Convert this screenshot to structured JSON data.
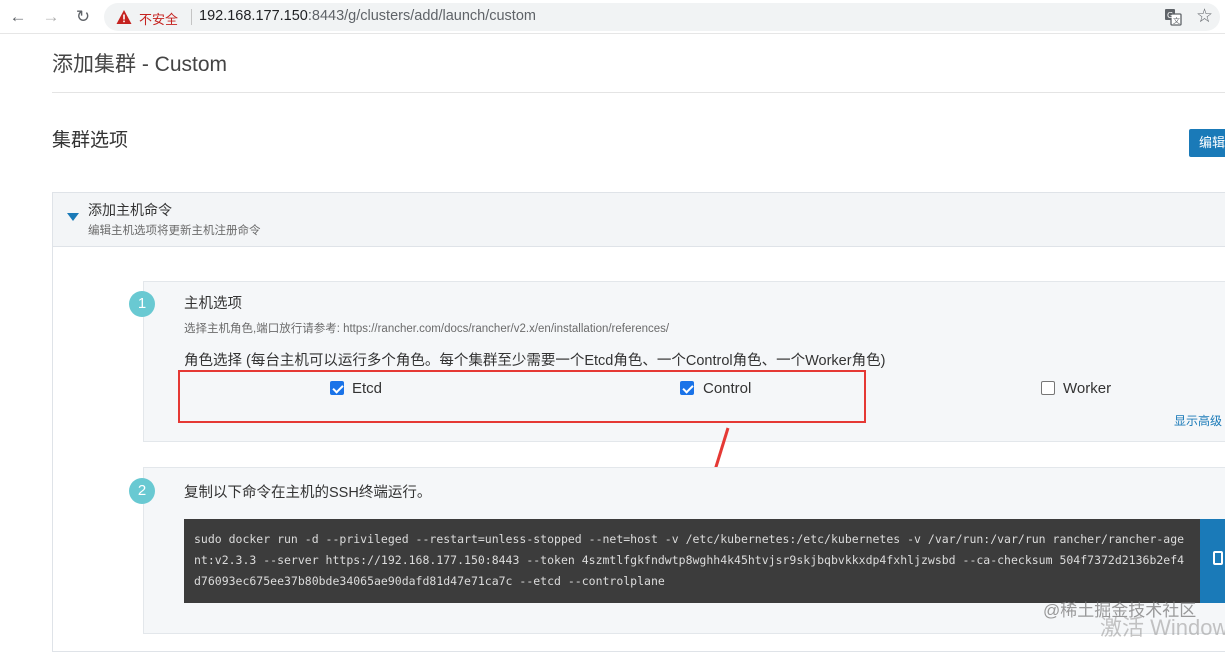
{
  "browser": {
    "security_label": "不安全",
    "url_host": "192.168.177.150",
    "url_rest": ":8443/g/clusters/add/launch/custom"
  },
  "page": {
    "title": "添加集群 - Custom",
    "section_title": "集群选项",
    "edit_button": "编辑"
  },
  "accordion": {
    "title": "添加主机命令",
    "subtitle": "编辑主机选项将更新主机注册命令"
  },
  "step1": {
    "number": "1",
    "title": "主机选项",
    "description": "选择主机角色,端口放行请参考: https://rancher.com/docs/rancher/v2.x/en/installation/references/",
    "role_title": "角色选择 (每台主机可以运行多个角色。每个集群至少需要一个Etcd角色、一个Control角色、一个Worker角色)",
    "roles": [
      {
        "label": "Etcd",
        "checked": true
      },
      {
        "label": "Control",
        "checked": true
      },
      {
        "label": "Worker",
        "checked": false
      }
    ],
    "show_advanced": "显示高级"
  },
  "step2": {
    "number": "2",
    "title": "复制以下命令在主机的SSH终端运行。",
    "command": "sudo docker run -d --privileged --restart=unless-stopped --net=host -v /etc/kubernetes:/etc/kubernetes -v /var/run:/var/run rancher/rancher-agent:v2.3.3 --server https://192.168.177.150:8443 --token 4szmtlfgkfndwtp8wghh4k45htvjsr9skjbqbvkkxdp4fxhljzwsbd --ca-checksum 504f7372d2136b2ef4d76093ec675ee37b80bde34065ae90dafd81d47e71ca7c --etcd --controlplane"
  },
  "overlay": {
    "watermark": "@稀土掘金技术社区",
    "activate": "激活 Window"
  },
  "colors": {
    "accent": "#1a7ab8",
    "step_circle": "#69c9d2",
    "highlight_red": "#e53935",
    "command_bg": "#3c3c3c"
  }
}
